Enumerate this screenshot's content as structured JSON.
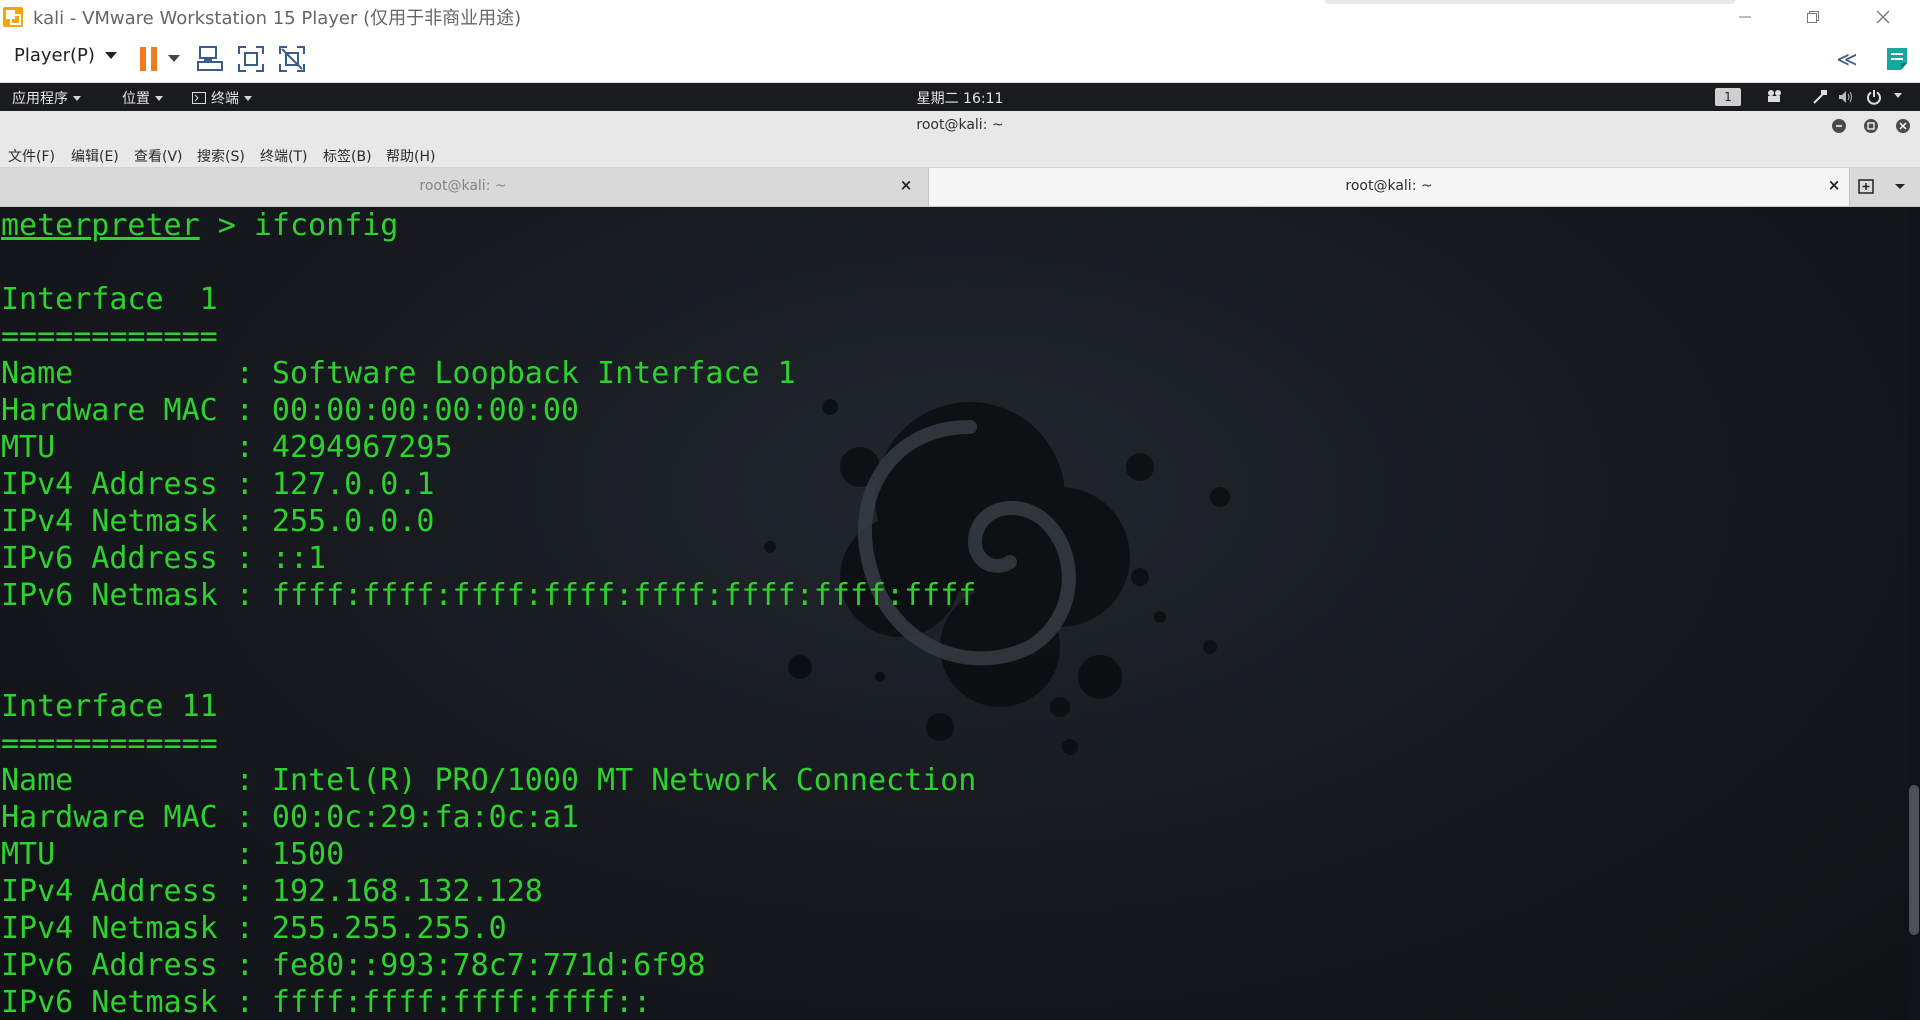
{
  "window": {
    "title": "kali - VMware Workstation 15 Player (仅用于非商业用途)",
    "controls": {
      "minimize_icon": "minimize-icon",
      "restore_icon": "restore-icon",
      "close_icon": "close-icon"
    }
  },
  "toolbar": {
    "player_menu": "Player(P)",
    "buttons": [
      {
        "name": "pause-button",
        "icon": "pause-icon"
      },
      {
        "name": "send-ctrl-alt-del-button",
        "icon": "ctrl-alt-del-icon"
      },
      {
        "name": "fullscreen-button",
        "icon": "fullscreen-icon"
      },
      {
        "name": "unity-button",
        "icon": "unity-icon"
      }
    ],
    "collapse_label": "≪"
  },
  "kali_panel": {
    "applications": "应用程序",
    "places": "位置",
    "terminal": "终端",
    "clock": "星期二 16:11",
    "workspace": "1"
  },
  "terminal_window": {
    "title": "root@kali: ~",
    "menu": [
      "文件(F)",
      "编辑(E)",
      "查看(V)",
      "搜索(S)",
      "终端(T)",
      "标签(B)",
      "帮助(H)"
    ],
    "tabs": [
      {
        "label": "root@kali: ~",
        "active": false
      },
      {
        "label": "root@kali: ~",
        "active": true
      }
    ]
  },
  "terminal": {
    "prompt": "meterpreter",
    "command": " > ifconfig",
    "lines": [
      "",
      "Interface  1",
      "============",
      "Name         : Software Loopback Interface 1",
      "Hardware MAC : 00:00:00:00:00:00",
      "MTU          : 4294967295",
      "IPv4 Address : 127.0.0.1",
      "IPv4 Netmask : 255.0.0.0",
      "IPv6 Address : ::1",
      "IPv6 Netmask : ffff:ffff:ffff:ffff:ffff:ffff:ffff:ffff",
      "",
      "",
      "Interface 11",
      "============",
      "Name         : Intel(R) PRO/1000 MT Network Connection",
      "Hardware MAC : 00:0c:29:fa:0c:a1",
      "MTU          : 1500",
      "IPv4 Address : 192.168.132.128",
      "IPv4 Netmask : 255.255.255.0",
      "IPv6 Address : fe80::993:78c7:771d:6f98",
      "IPv6 Netmask : ffff:ffff:ffff:ffff::"
    ]
  },
  "colors": {
    "terminal_text": "#2fd12f",
    "panel_bg": "#191b1f",
    "pause_orange": "#f07a1c"
  }
}
